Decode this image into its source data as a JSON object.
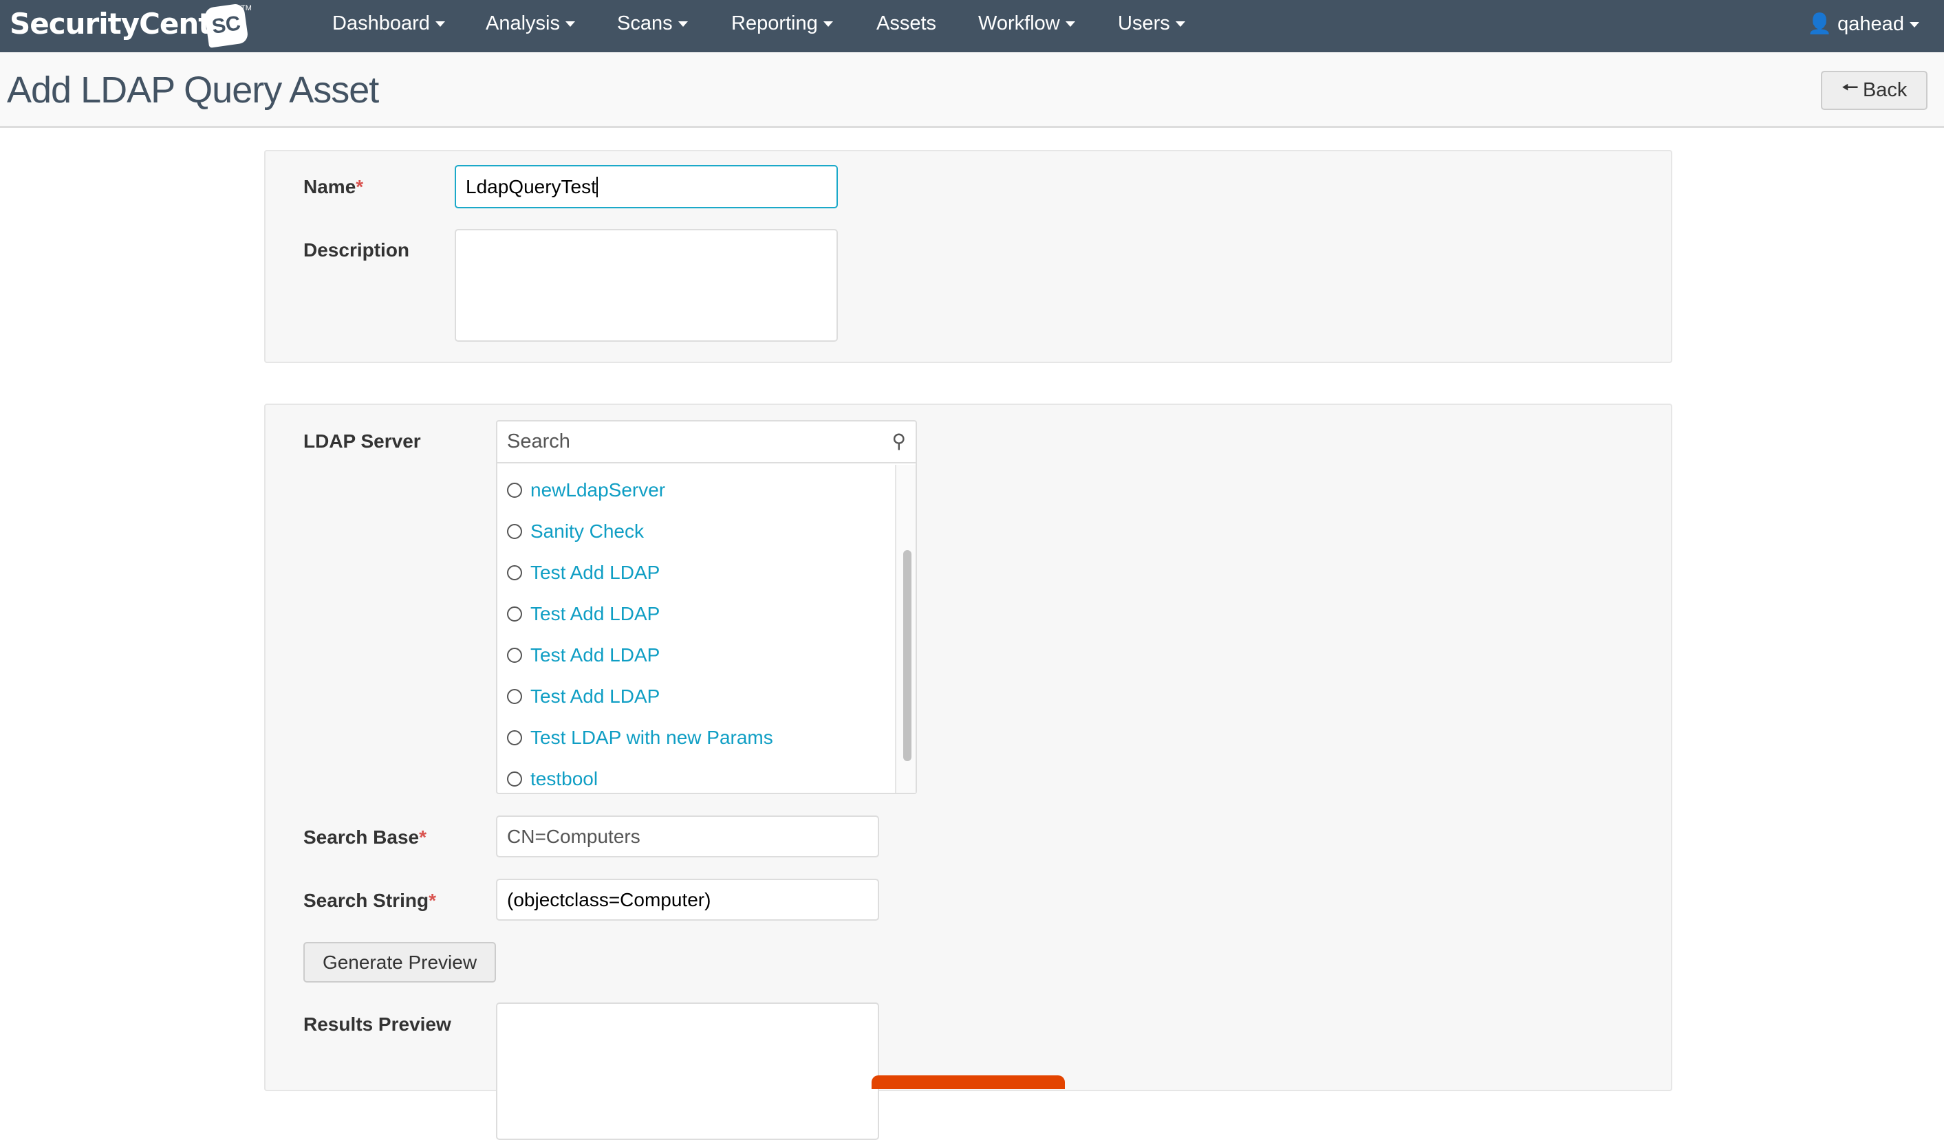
{
  "nav": {
    "brand": "SecurityCenter",
    "badge": "SC",
    "tm": "TM",
    "items": [
      {
        "label": "Dashboard",
        "caret": true
      },
      {
        "label": "Analysis",
        "caret": true
      },
      {
        "label": "Scans",
        "caret": true
      },
      {
        "label": "Reporting",
        "caret": true
      },
      {
        "label": "Assets",
        "caret": false
      },
      {
        "label": "Workflow",
        "caret": true
      },
      {
        "label": "Users",
        "caret": true
      }
    ],
    "user": "qahead"
  },
  "page": {
    "title": "Add LDAP Query Asset",
    "back_label": "Back"
  },
  "form": {
    "name_label": "Name",
    "name_value": "LdapQueryTest",
    "description_label": "Description",
    "description_value": "",
    "ldap_label": "LDAP Server",
    "search_placeholder": "Search",
    "servers": [
      "newLdapServer",
      "Sanity Check",
      "Test Add LDAP",
      "Test Add LDAP",
      "Test Add LDAP",
      "Test Add LDAP",
      "Test LDAP with new Params",
      "testbool"
    ],
    "search_base_label": "Search Base",
    "search_base_value": "CN=Computers",
    "search_string_label": "Search String",
    "search_string_value": "(objectclass=Computer)",
    "generate_label": "Generate Preview",
    "results_label": "Results Preview",
    "required_mark": "*"
  },
  "colors": {
    "navbar": "#435363",
    "link": "#0f9ec4",
    "accent": "#e34400"
  }
}
